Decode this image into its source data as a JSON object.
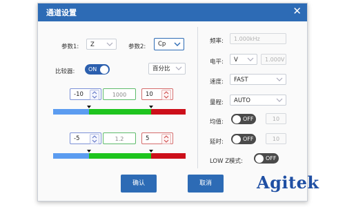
{
  "dialog": {
    "title": "通道设置",
    "close_symbol": "✕",
    "param1": {
      "label": "参数1:",
      "value": "Z"
    },
    "param2": {
      "label": "参数2:",
      "value": "Cp"
    },
    "comparator": {
      "label": "比较器:",
      "state": "ON",
      "mode": "百分比"
    },
    "limits1": {
      "low": "-10",
      "nominal": "1000",
      "high": "10"
    },
    "limits2": {
      "low": "-5",
      "nominal": "1.2",
      "high": "5"
    },
    "frequency": {
      "label": "频率:",
      "value": "1.000kHz"
    },
    "level": {
      "label": "电平:",
      "unit": "V",
      "value": "1.000V"
    },
    "speed": {
      "label": "速度:",
      "value": "FAST"
    },
    "range": {
      "label": "量程:",
      "value": "AUTO"
    },
    "average": {
      "label": "均值:",
      "state": "OFF",
      "value": "10"
    },
    "delay": {
      "label": "延时:",
      "state": "OFF",
      "value": "10"
    },
    "lowz": {
      "label": "LOW Z模式:",
      "state": "OFF"
    },
    "buttons": {
      "confirm": "确认",
      "cancel": "取消"
    }
  },
  "logo": {
    "text": "Agitek"
  },
  "colors": {
    "titlebar": "#2d6bb5",
    "bar_blue": "#5b9cf0",
    "bar_green": "#1ec41e",
    "bar_red": "#cc0f1a",
    "toggle_on": "#2b5fae",
    "toggle_off": "#4a4a4a"
  }
}
